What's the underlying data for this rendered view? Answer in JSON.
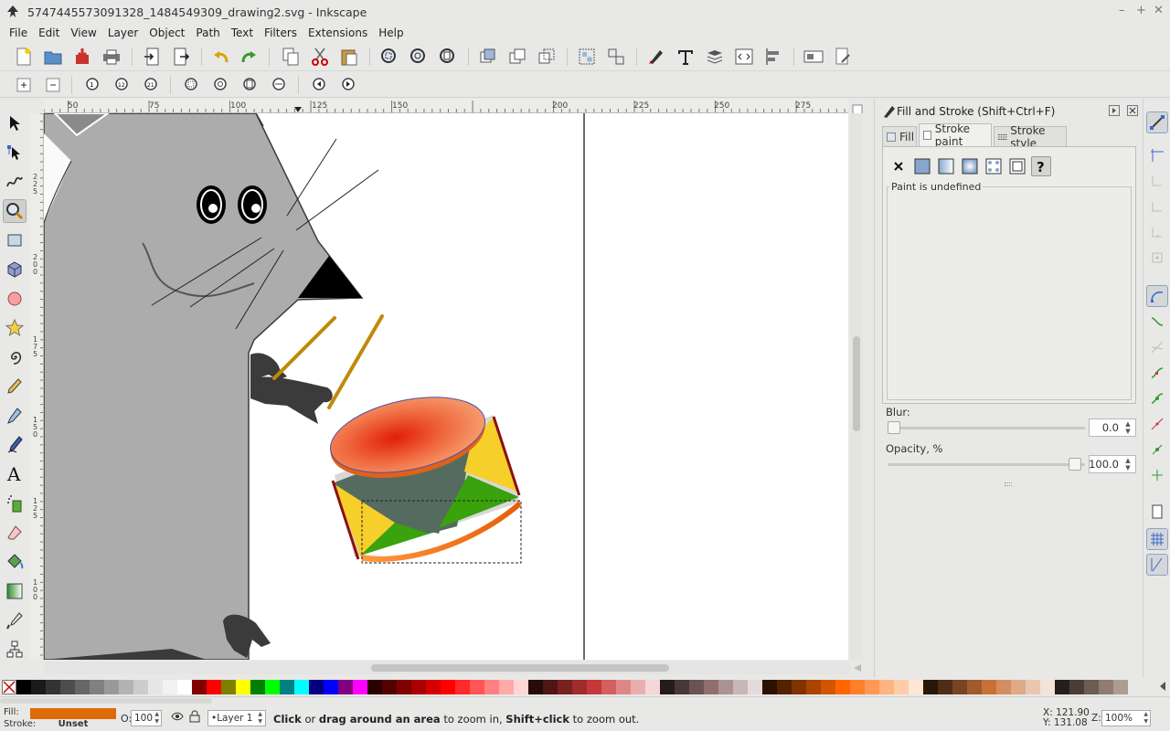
{
  "window": {
    "title": "5747445573091328_1484549309_drawing2.svg - Inkscape",
    "minimize": "–",
    "maximize": "+",
    "close": "✕"
  },
  "menu": [
    "File",
    "Edit",
    "View",
    "Layer",
    "Object",
    "Path",
    "Text",
    "Filters",
    "Extensions",
    "Help"
  ],
  "ruler": {
    "h_ticks": [
      "50",
      "75",
      "100",
      "125",
      "150",
      "200",
      "225",
      "250",
      "275"
    ],
    "v_ticks": [
      "2 2 5",
      "2 0 0",
      "1 7 5",
      "1 5 0",
      "1 2 5",
      "1 0 0"
    ]
  },
  "panel": {
    "title": "Fill and Stroke (Shift+Ctrl+F)",
    "tabs": [
      "Fill",
      "Stroke paint",
      "Stroke style"
    ],
    "active_tab": "Stroke paint",
    "paint_status": "Paint is undefined",
    "blur_label": "Blur:",
    "blur_value": "0.0",
    "opacity_label": "Opacity, %",
    "opacity_value": "100.0"
  },
  "status": {
    "fill_label": "Fill:",
    "stroke_label": "Stroke:",
    "fill_color": "#e06a08",
    "stroke_value": "Unset",
    "opacity_prefix": "O:",
    "opacity": "100",
    "layer": "•Layer 1",
    "message_bold1": "Click",
    "message_mid1": " or ",
    "message_bold2": "drag around an area",
    "message_mid2": " to zoom in, ",
    "message_bold3": "Shift+click",
    "message_end": " to zoom out.",
    "x_label": "X:",
    "x": "121.90",
    "y_label": "Y:",
    "y": "131.08",
    "zoom_label": "Z:",
    "zoom": "100%"
  },
  "palette": [
    "#000000",
    "#1a1a1a",
    "#333333",
    "#4d4d4d",
    "#666666",
    "#808080",
    "#999999",
    "#b3b3b3",
    "#cccccc",
    "#e6e6e6",
    "#f2f2f2",
    "#ffffff",
    "#800000",
    "#ff0000",
    "#808000",
    "#ffff00",
    "#008000",
    "#00ff00",
    "#008080",
    "#00ffff",
    "#000080",
    "#0000ff",
    "#800080",
    "#ff00ff",
    "#2b0000",
    "#550000",
    "#800000",
    "#aa0000",
    "#d40000",
    "#ff0000",
    "#ff2a2a",
    "#ff5555",
    "#ff8080",
    "#ffaaaa",
    "#ffd5d5",
    "#280b0b",
    "#501616",
    "#782121",
    "#a02c2c",
    "#c83737",
    "#d35f5f",
    "#de8787",
    "#e9afaf",
    "#f4d7d7",
    "#241c1c",
    "#483737",
    "#6c5353",
    "#916f6f",
    "#ac9393",
    "#c8b7b7",
    "#e3dbdb",
    "#2b1100",
    "#552200",
    "#803300",
    "#aa4400",
    "#d45500",
    "#ff6600",
    "#ff7f2a",
    "#ff9955",
    "#ffb380",
    "#ffccaa",
    "#ffe6d5",
    "#28170b",
    "#502d16",
    "#784421",
    "#a05a2c",
    "#c87137",
    "#d38d5f",
    "#deaa87",
    "#e9c6af",
    "#f4e3d7",
    "#241f1c",
    "#483e37",
    "#6c5d53",
    "#917c6f",
    "#ac9d93"
  ]
}
